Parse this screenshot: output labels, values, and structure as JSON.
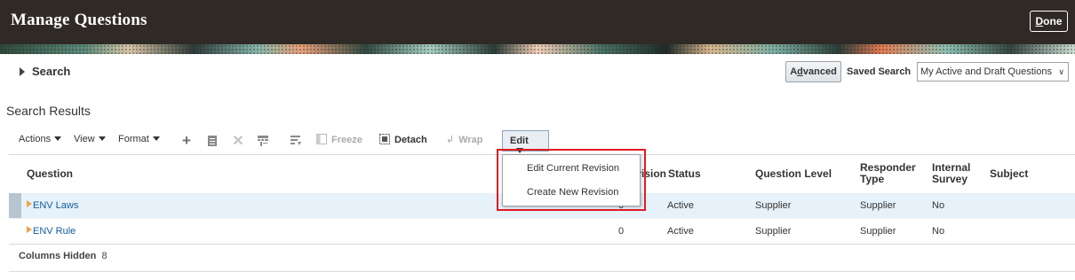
{
  "header": {
    "title": "Manage Questions",
    "done_pre": "D",
    "done_rest": "one"
  },
  "search": {
    "label": "Search",
    "advanced_pre": "A",
    "advanced_u": "d",
    "advanced_rest": "vanced",
    "saved_search_label": "Saved Search",
    "saved_search_value": "My Active and Draft Questions"
  },
  "results": {
    "title": "Search Results"
  },
  "toolbar": {
    "actions": "Actions",
    "view": "View",
    "format": "Format",
    "freeze": "Freeze",
    "detach": "Detach",
    "wrap": "Wrap",
    "edit": "Edit"
  },
  "menu": {
    "items": [
      "Edit Current Revision",
      "Create New Revision"
    ]
  },
  "table": {
    "columns": {
      "question": "Question",
      "revision": "Revision",
      "status": "Status",
      "question_level": "Question Level",
      "responder_type_1": "Responder",
      "responder_type_2": "Type",
      "internal_survey_1": "Internal",
      "internal_survey_2": "Survey",
      "subject": "Subject"
    },
    "rows": [
      {
        "question": "ENV Laws",
        "revision": "0",
        "status": "Active",
        "question_level": "Supplier",
        "responder_type": "Supplier",
        "internal_survey": "No",
        "subject": ""
      },
      {
        "question": "ENV Rule",
        "revision": "0",
        "status": "Active",
        "question_level": "Supplier",
        "responder_type": "Supplier",
        "internal_survey": "No",
        "subject": ""
      }
    ]
  },
  "footer": {
    "columns_hidden_label": "Columns Hidden",
    "columns_hidden_count": "8"
  }
}
